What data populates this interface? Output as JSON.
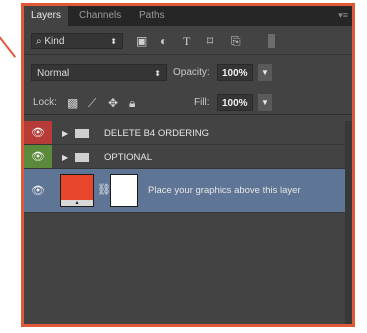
{
  "panel": {
    "tabs": [
      "Layers",
      "Channels",
      "Paths"
    ],
    "active_tab": 0,
    "menu_icon": "panel-menu-icon"
  },
  "filter": {
    "kind_label": "Kind",
    "icons": [
      "image-filter-icon",
      "adjustment-filter-icon",
      "type-filter-icon",
      "shape-filter-icon",
      "smart-object-filter-icon"
    ]
  },
  "blend": {
    "mode": "Normal",
    "opacity_label": "Opacity:",
    "opacity_value": "100%"
  },
  "lock": {
    "label": "Lock:",
    "icons": [
      "lock-transparent-icon",
      "lock-brush-icon",
      "lock-move-icon",
      "lock-all-icon"
    ],
    "fill_label": "Fill:",
    "fill_value": "100%"
  },
  "layers": [
    {
      "name": "DELETE B4 ORDERING",
      "type": "group",
      "color": "#b73c38"
    },
    {
      "name": "OPTIONAL",
      "type": "group",
      "color": "#5c8a3c"
    },
    {
      "name": "Place your graphics above this layer",
      "type": "smart-object",
      "color": "",
      "selected": true,
      "thumb_color": "#e8452d"
    }
  ],
  "colors": {
    "accent_frame": "#e05a3a",
    "selected_row": "#5f7596",
    "panel_bg": "#434343"
  }
}
